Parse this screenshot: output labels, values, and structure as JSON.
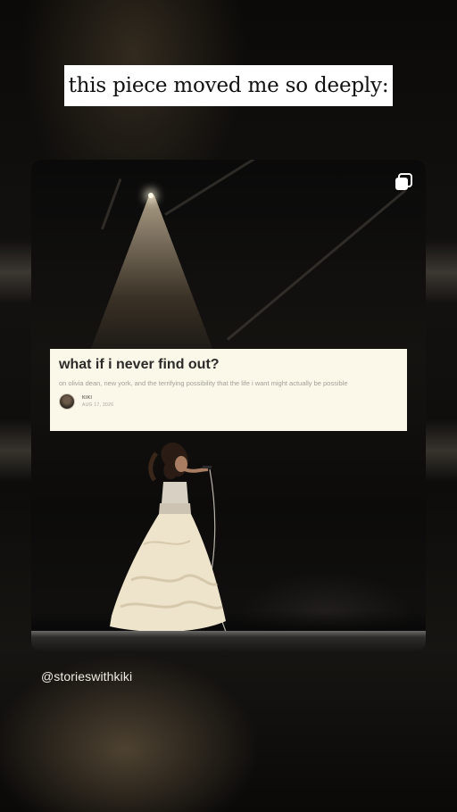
{
  "story": {
    "headline": "this piece moved me so deeply:",
    "handle": "@storieswithkiki"
  },
  "post": {
    "multi_image_icon": "carousel-icon",
    "article": {
      "title": "what if i never find out?",
      "subtitle": "on olivia dean, new york, and the terrifying possibility that the life i want might actually be possible",
      "author": "KIKI",
      "date": "AUG 17, 2026"
    }
  },
  "colors": {
    "background": "#050505",
    "headline_box": "#ffffff",
    "card_background": "#fbf7e9",
    "card_title": "#2b2a28",
    "handle_text": "#f1ece4"
  }
}
